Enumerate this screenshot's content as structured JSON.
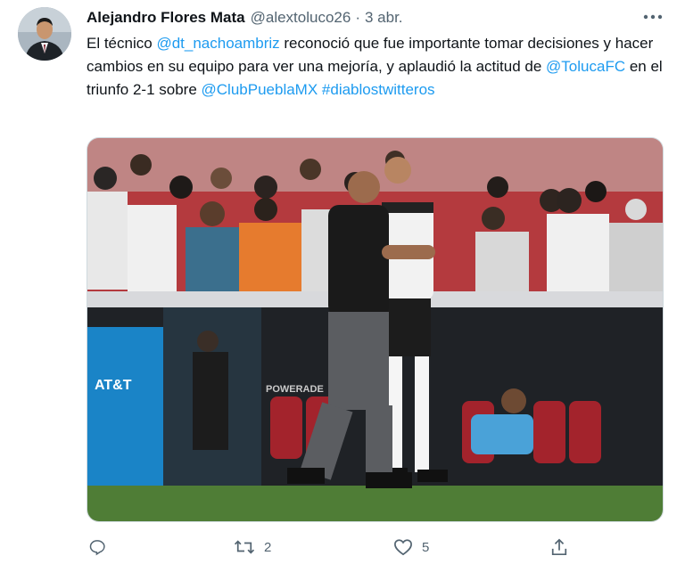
{
  "tweet": {
    "author": {
      "name": "Alejandro Flores Mata",
      "handle": "@alextoluco26",
      "separator": "·",
      "date": "3 abr."
    },
    "text": {
      "intro": "El técnico ",
      "mention1": "@dt_nachoambriz",
      "mid1": " reconoció que fue importante tomar decisiones y hacer cambios en su equipo para ver una mejoría, y aplaudió la actitud de ",
      "mention2": "@TolucaFC",
      "mid2": " en el triunfo 2-1 sobre ",
      "mention3": "@ClubPueblaMX",
      "space": " ",
      "hashtag": "#diablostwitteros"
    },
    "media": {
      "banner_text": "AT&T",
      "stadium_board_text": "POWERADE"
    },
    "actions": {
      "reply_icon": "reply-icon",
      "retweet_icon": "retweet-icon",
      "retweet_count": "2",
      "like_icon": "heart-icon",
      "like_count": "5",
      "share_icon": "share-icon"
    },
    "colors": {
      "link": "#1d9bf0",
      "secondary_text": "#536471",
      "primary_text": "#0f1419"
    }
  }
}
